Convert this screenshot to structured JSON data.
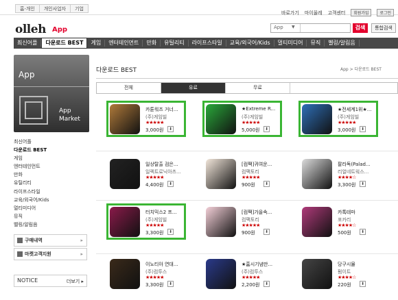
{
  "top_tabs": [
    "홈-개인",
    "개인사업자",
    "기업"
  ],
  "top_links": [
    "바로가기",
    "마이올레",
    "고객센터",
    "회원가입",
    "로그인"
  ],
  "logo": "olleh",
  "logo_sub": "App",
  "search": {
    "category": "App",
    "button": "검색",
    "button2": "통합검색"
  },
  "nav": [
    "최신어플",
    "다운로드 BEST",
    "게임",
    "엔터테인먼트",
    "만화",
    "유틸리티",
    "라이프스타일",
    "교육/외국어/Kids",
    "멀티미디어",
    "뮤직",
    "벨링/알림음"
  ],
  "side": {
    "head": "App",
    "market": [
      "App",
      "Market"
    ],
    "menu": [
      "최신어플",
      "다운로드 BEST",
      "게임",
      "엔터테인먼트",
      "만화",
      "유틸리티",
      "라이프스타일",
      "교육/외국어/Kids",
      "멀티미디어",
      "뮤직",
      "벨링/알림음"
    ],
    "box1": "구매내역",
    "box2": "마켓고객지원",
    "notice": "NOTICE",
    "notice_more": "더보기"
  },
  "main": {
    "title": "다운로드 BEST",
    "breadcrumb": "App > 다운로드 BEST",
    "tabs": [
      "전체",
      "유료",
      "무료"
    ]
  },
  "apps": [
    {
      "name": "카툰워즈 거너...",
      "company": "(주)게임빌",
      "price": "3,000원",
      "stars": "★★★★★",
      "color": "#b07a3a"
    },
    {
      "name": "★Extreme R...",
      "company": "(주)게임빌",
      "price": "5,000원",
      "stars": "★★★★★",
      "color": "#2aa83a"
    },
    {
      "name": "★전세계1위★...",
      "company": "(주)게임빌",
      "price": "3,000원",
      "stars": "★★★★★",
      "color": "#2e6fb8"
    },
    {
      "name": "일상탈출 검은...",
      "company": "일렉트로닉아츠...",
      "price": "4,400원",
      "stars": "★★★★★",
      "color": "#222222"
    },
    {
      "name": "[컴팩]귀여운...",
      "company": "컴팩토리",
      "price": "900원",
      "stars": "★★★★★",
      "color": "#f2e6da"
    },
    {
      "name": "팔라독(Palad...",
      "company": "리얼네트웍스...",
      "price": "3,300원",
      "stars": "★★★★☆",
      "color": "#dcdcdc"
    },
    {
      "name": "터치믹스2 프...",
      "company": "(주)게임빌",
      "price": "3,300원",
      "stars": "★★★★★",
      "color": "#8a1a4a"
    },
    {
      "name": "[컴팩]가을속...",
      "company": "컴팩토리",
      "price": "900원",
      "stars": "★★★★★",
      "color": "#f4d0d8"
    },
    {
      "name": "카톡테마",
      "company": "포카리",
      "price": "500원",
      "stars": "★★★★☆",
      "color": "#b03a7a"
    },
    {
      "name": "이노티아 연대...",
      "company": "(주)컴투스",
      "price": "3,300원",
      "stars": "★★★★★",
      "color": "#3a2a1a"
    },
    {
      "name": "★홈시기념만...",
      "company": "(주)컴투스",
      "price": "2,200원",
      "stars": "★★★★★",
      "color": "#2a3a8a"
    },
    {
      "name": "당구시뮬",
      "company": "펌이트",
      "price": "220원",
      "stars": "★★★★☆",
      "color": "#444444"
    }
  ]
}
